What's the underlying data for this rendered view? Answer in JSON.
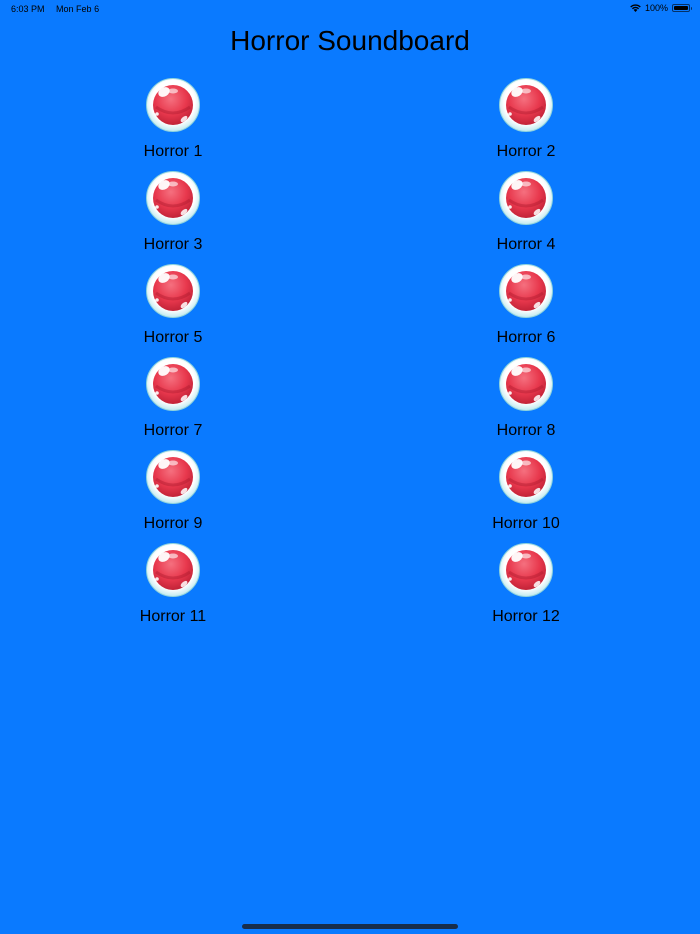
{
  "status_bar": {
    "time": "6:03 PM",
    "date": "Mon Feb 6",
    "battery": "100%"
  },
  "title": "Horror Soundboard",
  "sounds": [
    {
      "label": "Horror 1"
    },
    {
      "label": "Horror 2"
    },
    {
      "label": "Horror 3"
    },
    {
      "label": "Horror 4"
    },
    {
      "label": "Horror 5"
    },
    {
      "label": "Horror 6"
    },
    {
      "label": "Horror 7"
    },
    {
      "label": "Horror 8"
    },
    {
      "label": "Horror 9"
    },
    {
      "label": "Horror 10"
    },
    {
      "label": "Horror 11"
    },
    {
      "label": "Horror 12"
    }
  ],
  "colors": {
    "background": "#0a7aff",
    "bubble_red": "#e8384d",
    "bubble_rim": "#cfeef2"
  }
}
